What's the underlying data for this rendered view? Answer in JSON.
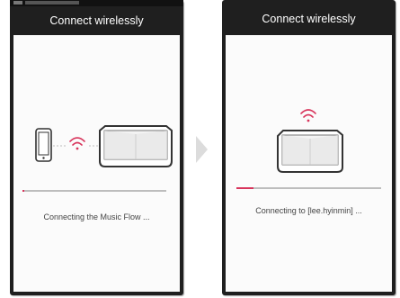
{
  "steps": [
    {
      "title": "Connect wirelessly",
      "status_text": "Connecting the Music Flow ...",
      "progress": 0.01
    },
    {
      "title": "Connect wirelessly",
      "status_text": "Connecting to [lee.hyinmin] ...",
      "progress": 0.12
    }
  ],
  "colors": {
    "titlebar": "#1f1f1f",
    "accent": "#d8355c",
    "track": "#bdbdbd"
  },
  "icons": [
    "phone-icon",
    "wifi-icon",
    "speaker-icon",
    "next-step-arrow-icon"
  ]
}
